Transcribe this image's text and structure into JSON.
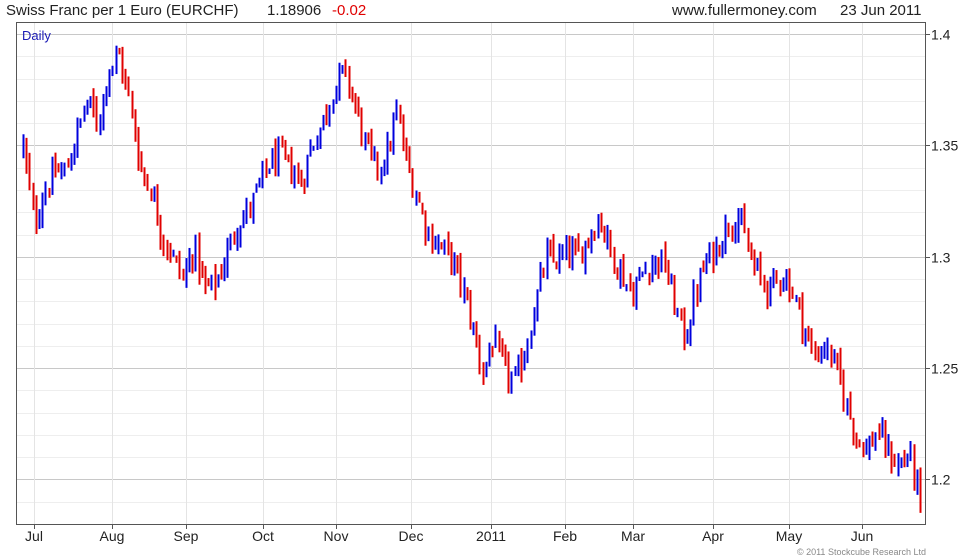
{
  "header": {
    "title": "Swiss Franc per 1 Euro (EURCHF)",
    "price": "1.18906",
    "change": "-0.02",
    "website": "www.fullermoney.com",
    "date": "23 Jun 2011"
  },
  "period_label": "Daily",
  "copyright": "© 2011 Stockcube Research Ltd",
  "colors": {
    "up": "#0000dd",
    "down": "#e00000",
    "grid": "#dddddd"
  },
  "chart_data": {
    "type": "bar",
    "subtype": "ohlc",
    "title": "Swiss Franc per 1 Euro (EURCHF)",
    "xlabel": "",
    "ylabel": "",
    "ylim": [
      1.18,
      1.405
    ],
    "y_ticks": [
      1.2,
      1.25,
      1.3,
      1.35,
      1.4
    ],
    "y_tick_labels": [
      "1.2",
      "1.25",
      "1.3",
      "1.35",
      "1.4"
    ],
    "x_tick_labels": [
      "Jul",
      "Aug",
      "Sep",
      "Oct",
      "Nov",
      "Dec",
      "2011",
      "Feb",
      "Mar",
      "Apr",
      "May",
      "Jun"
    ],
    "grid": true,
    "weekly_closes": [
      1.35,
      1.315,
      1.33,
      1.338,
      1.338,
      1.355,
      1.37,
      1.36,
      1.385,
      1.39,
      1.368,
      1.34,
      1.33,
      1.31,
      1.3,
      1.29,
      1.305,
      1.285,
      1.288,
      1.3,
      1.315,
      1.32,
      1.33,
      1.342,
      1.345,
      1.34,
      1.333,
      1.35,
      1.36,
      1.375,
      1.383,
      1.37,
      1.35,
      1.34,
      1.345,
      1.365,
      1.34,
      1.325,
      1.31,
      1.305,
      1.3,
      1.288,
      1.27,
      1.248,
      1.262,
      1.25,
      1.243,
      1.258,
      1.28,
      1.3,
      1.298,
      1.302,
      1.3,
      1.31,
      1.318,
      1.302,
      1.293,
      1.283,
      1.293,
      1.298,
      1.298,
      1.278,
      1.263,
      1.285,
      1.298,
      1.305,
      1.315,
      1.318,
      1.3,
      1.29,
      1.285,
      1.293,
      1.285,
      1.27,
      1.255,
      1.26,
      1.252,
      1.235,
      1.22,
      1.213,
      1.222,
      1.212,
      1.206,
      1.212,
      1.19
    ]
  }
}
